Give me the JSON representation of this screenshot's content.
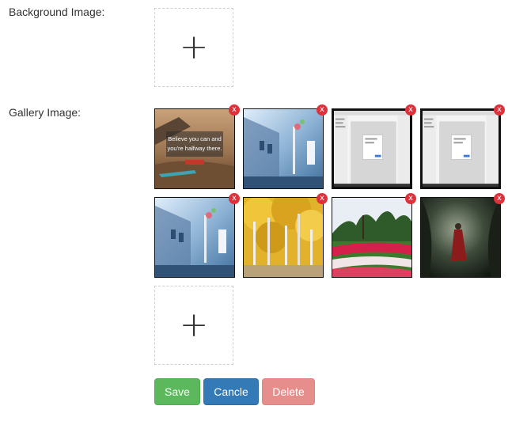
{
  "background": {
    "label": "Background Image:",
    "add_symbol": "+"
  },
  "gallery": {
    "label": "Gallery Image:",
    "add_symbol": "+",
    "remove_symbol": "x",
    "items": [
      {
        "name": "quote-beach-image",
        "caption_line1": "Believe you can and",
        "caption_line2": "you're halfway there."
      },
      {
        "name": "blue-street-image"
      },
      {
        "name": "app-screenshot-image"
      },
      {
        "name": "app-screenshot-image"
      },
      {
        "name": "blue-street-image"
      },
      {
        "name": "yellow-birch-forest-image"
      },
      {
        "name": "tulip-field-image"
      },
      {
        "name": "red-cloak-forest-image"
      }
    ]
  },
  "actions": {
    "save_label": "Save",
    "cancel_label": "Cancle",
    "delete_label": "Delete"
  },
  "colors": {
    "save": "#5cb85c",
    "cancel": "#337ab7",
    "delete": "#d9534f",
    "remove_badge": "#e0303a"
  }
}
